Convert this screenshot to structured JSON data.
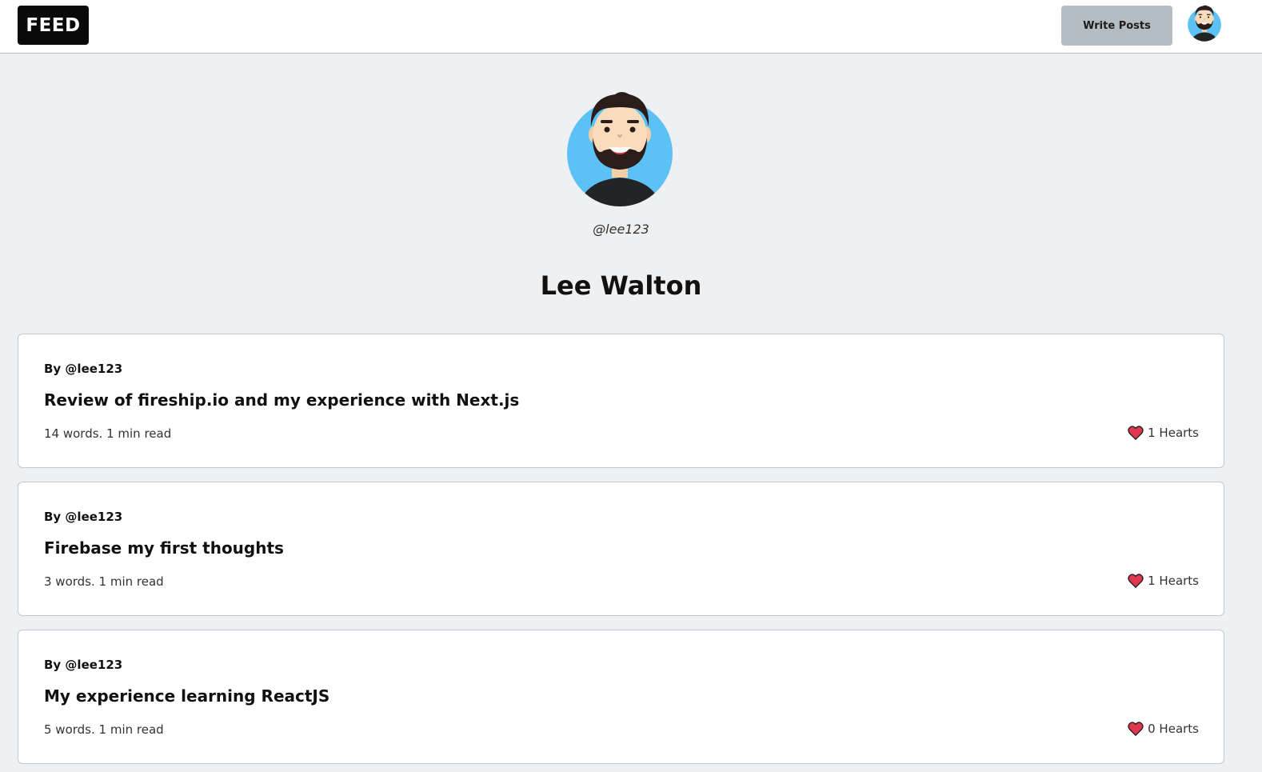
{
  "nav": {
    "logo": "FEED",
    "write_button": "Write Posts"
  },
  "profile": {
    "username": "@lee123",
    "display_name": "Lee Walton"
  },
  "posts": [
    {
      "author": "By @lee123",
      "title": "Review of fireship.io and my experience with Next.js",
      "meta": "14 words. 1 min read",
      "hearts": "1 Hearts"
    },
    {
      "author": "By @lee123",
      "title": "Firebase my first thoughts",
      "meta": "3 words. 1 min read",
      "hearts": "1 Hearts"
    },
    {
      "author": "By @lee123",
      "title": "My experience learning ReactJS",
      "meta": "5 words. 1 min read",
      "hearts": "0 Hearts"
    }
  ],
  "colors": {
    "background": "#eef0f1",
    "logo_bg": "#0a0a0a",
    "button_bg": "#b5bdc4",
    "avatar_bg": "#5cc1f5",
    "heart": "#e0384f"
  },
  "icons": {
    "nav_avatar": "avatar-icon",
    "profile_avatar": "avatar-icon",
    "heart": "heart-icon"
  }
}
